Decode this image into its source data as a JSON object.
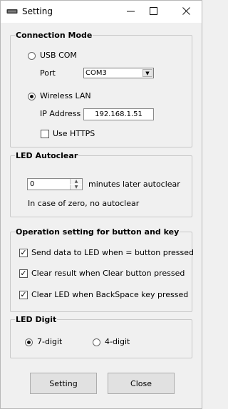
{
  "window": {
    "title": "Setting",
    "minimize_icon": "minimize-icon",
    "maximize_icon": "maximize-icon",
    "close_icon": "close-icon"
  },
  "connection": {
    "legend": "Connection Mode",
    "usb_label": "USB COM",
    "usb_selected": false,
    "port_label": "Port",
    "port_value": "COM3",
    "wlan_label": "Wireless LAN",
    "wlan_selected": true,
    "ip_label": "IP Address",
    "ip_value": "192.168.1.51",
    "https_label": "Use HTTPS",
    "https_checked": false
  },
  "autoclear": {
    "legend": "LED Autoclear",
    "minutes_value": "0",
    "minutes_label": "minutes later autoclear",
    "note": "In case of zero, no autoclear"
  },
  "operation": {
    "legend": "Operation setting for button and key",
    "items": [
      {
        "label": "Send data to LED when = button pressed",
        "checked": true
      },
      {
        "label": "Clear result when Clear button pressed",
        "checked": true
      },
      {
        "label": "Clear LED when BackSpace key pressed",
        "checked": true
      }
    ]
  },
  "digit": {
    "legend": "LED Digit",
    "opt7_label": "7-digit",
    "opt7_selected": true,
    "opt4_label": "4-digit",
    "opt4_selected": false
  },
  "buttons": {
    "setting": "Setting",
    "close": "Close"
  }
}
